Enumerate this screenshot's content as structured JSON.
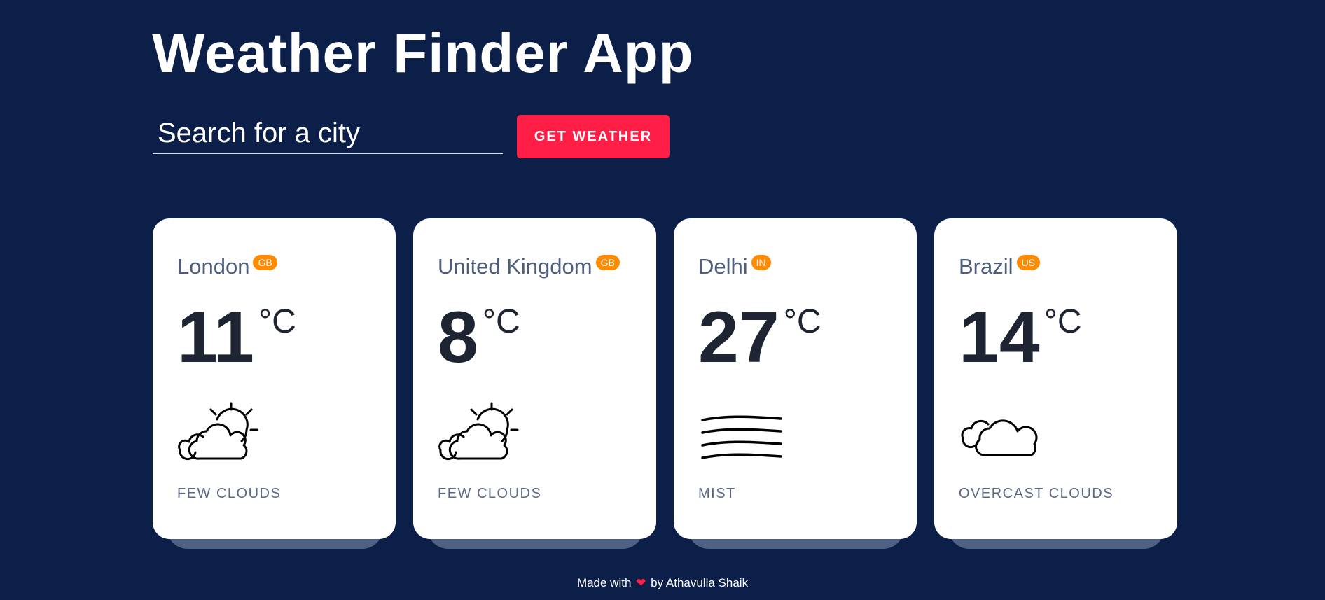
{
  "app": {
    "title": "Weather Finder App"
  },
  "search": {
    "placeholder": "Search for a city",
    "button_label": "GET WEATHER"
  },
  "cards": [
    {
      "city": "London",
      "country": "GB",
      "temperature": "11",
      "unit": "°C",
      "icon": "partly-cloudy-icon",
      "description": "FEW CLOUDS"
    },
    {
      "city": "United Kingdom",
      "country": "GB",
      "temperature": "8",
      "unit": "°C",
      "icon": "partly-cloudy-icon",
      "description": "FEW CLOUDS"
    },
    {
      "city": "Delhi",
      "country": "IN",
      "temperature": "27",
      "unit": "°C",
      "icon": "mist-icon",
      "description": "MIST"
    },
    {
      "city": "Brazil",
      "country": "US",
      "temperature": "14",
      "unit": "°C",
      "icon": "overcast-clouds-icon",
      "description": "OVERCAST CLOUDS"
    }
  ],
  "footer": {
    "made_with": "Made with",
    "heart": "❤",
    "by": "by Athavulla Shaik"
  },
  "colors": {
    "background": "#0b1f49",
    "accent": "#ff1e46",
    "badge": "#ff8b02",
    "card": "#ffffff"
  }
}
